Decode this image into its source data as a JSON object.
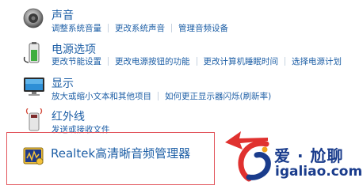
{
  "items": [
    {
      "title": "声音",
      "links": [
        "调整系统音量",
        "更改系统声音",
        "管理音频设备"
      ],
      "icon": "speaker-icon"
    },
    {
      "title": "电源选项",
      "links": [
        "更改节能设置",
        "更改电源按钮的功能",
        "更改计算机睡眠时间",
        "选择电源计划"
      ],
      "icon": "battery-icon"
    },
    {
      "title": "显示",
      "links": [
        "放大或缩小文本和其他项目",
        "如何更正显示器闪烁(刷新率)"
      ],
      "icon": "monitor-icon"
    },
    {
      "title": "红外线",
      "links": [
        "发送或接收文件"
      ],
      "icon": "infrared-icon"
    },
    {
      "title": "Realtek高清晰音频管理器",
      "links": [],
      "icon": "realtek-audio-icon"
    }
  ],
  "watermark": {
    "cn_text": "爱 · 尬聊",
    "domain": "igaliao.com"
  },
  "colors": {
    "link": "#1e5fa6",
    "highlight_border": "#e2555c",
    "arrow": "#e0312f",
    "watermark": "#1a3c8c"
  }
}
